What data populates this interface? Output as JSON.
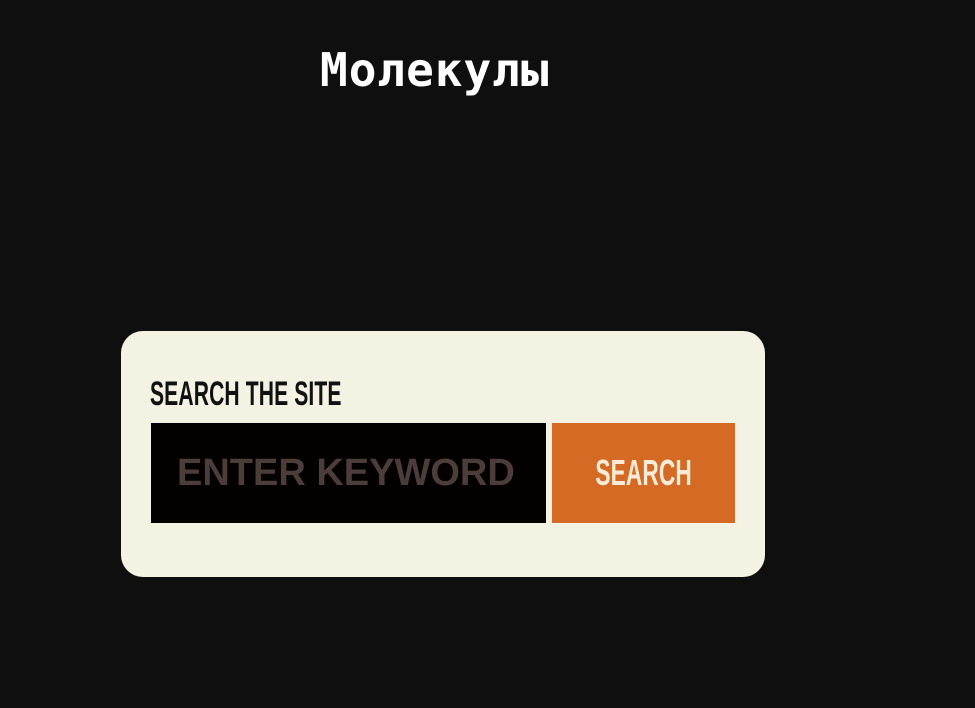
{
  "page": {
    "title": "Молекулы"
  },
  "search": {
    "heading": "SEARCH THE SITE",
    "placeholder": "ENTER KEYWORD",
    "value": "",
    "button_label": "SEARCH"
  },
  "colors": {
    "background": "#0f0f0f",
    "card": "#f4f2e3",
    "input": "#050000",
    "placeholder": "#4b3d39",
    "button": "#d46a24",
    "button_text": "#f8ecd8"
  }
}
